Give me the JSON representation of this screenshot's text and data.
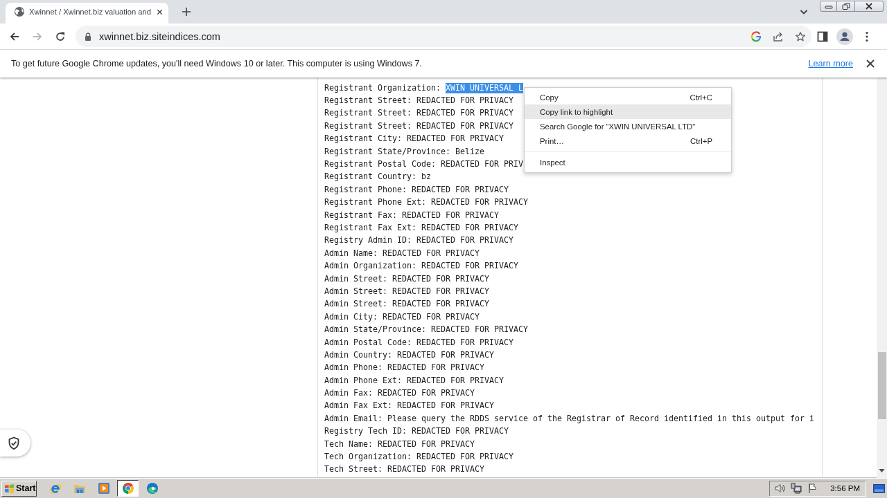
{
  "tabs": [
    {
      "title": "Xwinnet / Xwinnet.biz valuation and",
      "selected": true
    }
  ],
  "navigation": [
    {
      "kind": "back",
      "disabled": false
    },
    {
      "kind": "forward",
      "disabled": true
    },
    {
      "kind": "reload",
      "disabled": false
    }
  ],
  "address_bar": {
    "url": "xwinnet.biz.siteindices.com"
  },
  "infobar": {
    "message": "To get future Google Chrome updates, you'll need Windows 10 or later. This computer is using Windows 7.",
    "link": "Learn more"
  },
  "whois_lines": [
    {
      "text": "Registrant Organization:",
      "selected_text": "XWIN UNIVERSAL L"
    },
    {
      "text": "Registrant Street: REDACTED FOR PRIVACY"
    },
    {
      "text": "Registrant Street: REDACTED FOR PRIVACY"
    },
    {
      "text": "Registrant Street: REDACTED FOR PRIVACY"
    },
    {
      "text": "Registrant City: REDACTED FOR PRIVACY"
    },
    {
      "text": "Registrant State/Province: Belize"
    },
    {
      "text": "Registrant Postal Code: REDACTED FOR PRIV"
    },
    {
      "text": "Registrant Country: bz"
    },
    {
      "text": "Registrant Phone: REDACTED FOR PRIVACY"
    },
    {
      "text": "Registrant Phone Ext: REDACTED FOR PRIVACY"
    },
    {
      "text": "Registrant Fax: REDACTED FOR PRIVACY"
    },
    {
      "text": "Registrant Fax Ext: REDACTED FOR PRIVACY"
    },
    {
      "text": "Registry Admin ID: REDACTED FOR PRIVACY"
    },
    {
      "text": "Admin Name: REDACTED FOR PRIVACY"
    },
    {
      "text": "Admin Organization: REDACTED FOR PRIVACY"
    },
    {
      "text": "Admin Street: REDACTED FOR PRIVACY"
    },
    {
      "text": "Admin Street: REDACTED FOR PRIVACY"
    },
    {
      "text": "Admin Street: REDACTED FOR PRIVACY"
    },
    {
      "text": "Admin City: REDACTED FOR PRIVACY"
    },
    {
      "text": "Admin State/Province: REDACTED FOR PRIVACY"
    },
    {
      "text": "Admin Postal Code: REDACTED FOR PRIVACY"
    },
    {
      "text": "Admin Country: REDACTED FOR PRIVACY"
    },
    {
      "text": "Admin Phone: REDACTED FOR PRIVACY"
    },
    {
      "text": "Admin Phone Ext: REDACTED FOR PRIVACY"
    },
    {
      "text": "Admin Fax: REDACTED FOR PRIVACY"
    },
    {
      "text": "Admin Fax Ext: REDACTED FOR PRIVACY"
    },
    {
      "text": "Admin Email: Please query the RDDS service of the Registrar of Record identified in this output for i"
    },
    {
      "text": "Registry Tech ID: REDACTED FOR PRIVACY"
    },
    {
      "text": "Tech Name: REDACTED FOR PRIVACY"
    },
    {
      "text": "Tech Organization: REDACTED FOR PRIVACY"
    },
    {
      "text": "Tech Street: REDACTED FOR PRIVACY"
    }
  ],
  "context_menu": {
    "groups": [
      [
        {
          "label": "Copy",
          "shortcut": "Ctrl+C",
          "selected": false
        },
        {
          "label": "Copy link to highlight",
          "selected": true
        },
        {
          "label": "Search Google for “XWIN UNIVERSAL LTD”",
          "selected": false
        },
        {
          "label": "Print…",
          "shortcut": "Ctrl+P",
          "selected": false
        }
      ],
      [
        {
          "label": "Inspect",
          "selected": false
        }
      ]
    ]
  },
  "taskbar": {
    "start": "Start",
    "apps": [
      {
        "kind": "ie",
        "selected": false
      },
      {
        "kind": "folder",
        "selected": false
      },
      {
        "kind": "player",
        "selected": false
      },
      {
        "kind": "chrome",
        "selected": true
      },
      {
        "kind": "edge",
        "selected": false
      }
    ],
    "clock": "3:56 PM"
  }
}
